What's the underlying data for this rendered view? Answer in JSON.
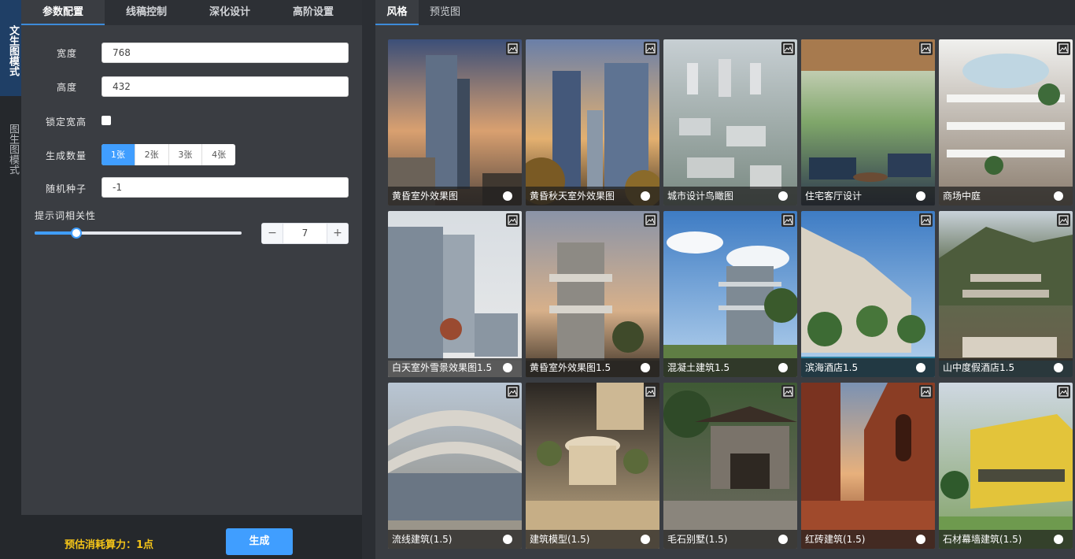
{
  "modes": {
    "text_to_image": "文生图模式",
    "image_to_image": "图生图模式"
  },
  "settings_tabs": [
    "参数配置",
    "线稿控制",
    "深化设计",
    "高阶设置"
  ],
  "form": {
    "width_label": "宽度",
    "width_value": "768",
    "height_label": "高度",
    "height_value": "432",
    "lock_label": "锁定宽高",
    "lock_checked": false,
    "count_label": "生成数量",
    "count_options": [
      "1张",
      "2张",
      "3张",
      "4张"
    ],
    "count_selected": "1张",
    "seed_label": "随机种子",
    "seed_value": "-1",
    "relevance_label": "提示词相关性",
    "relevance_value": "7",
    "relevance_fraction": 0.2,
    "minus": "−",
    "plus": "+"
  },
  "footer": {
    "cost": "预估消耗算力：1点",
    "generate_label": "生成"
  },
  "right_tabs": [
    "风格",
    "预览图"
  ],
  "styles": [
    {
      "caption": "黄昏室外效果图",
      "art": "dusk-tower"
    },
    {
      "caption": "黄昏秋天室外效果图",
      "art": "autumn-tower"
    },
    {
      "caption": "城市设计鸟瞰图",
      "art": "aerial"
    },
    {
      "caption": "住宅客厅设计",
      "art": "living"
    },
    {
      "caption": "商场中庭",
      "art": "atrium"
    },
    {
      "caption": "白天室外雪景效果图1.5",
      "art": "snow"
    },
    {
      "caption": "黄昏室外效果图1.5",
      "art": "dusk-block"
    },
    {
      "caption": "混凝土建筑1.5",
      "art": "concrete"
    },
    {
      "caption": "滨海酒店1.5",
      "art": "seaside"
    },
    {
      "caption": "山中度假酒店1.5",
      "art": "mountain"
    },
    {
      "caption": "流线建筑(1.5)",
      "art": "stream"
    },
    {
      "caption": "建筑模型(1.5)",
      "art": "model"
    },
    {
      "caption": "毛石别墅(1.5)",
      "art": "villa"
    },
    {
      "caption": "红砖建筑(1.5)",
      "art": "brick"
    },
    {
      "caption": "石材幕墙建筑(1.5)",
      "art": "yellow"
    }
  ]
}
